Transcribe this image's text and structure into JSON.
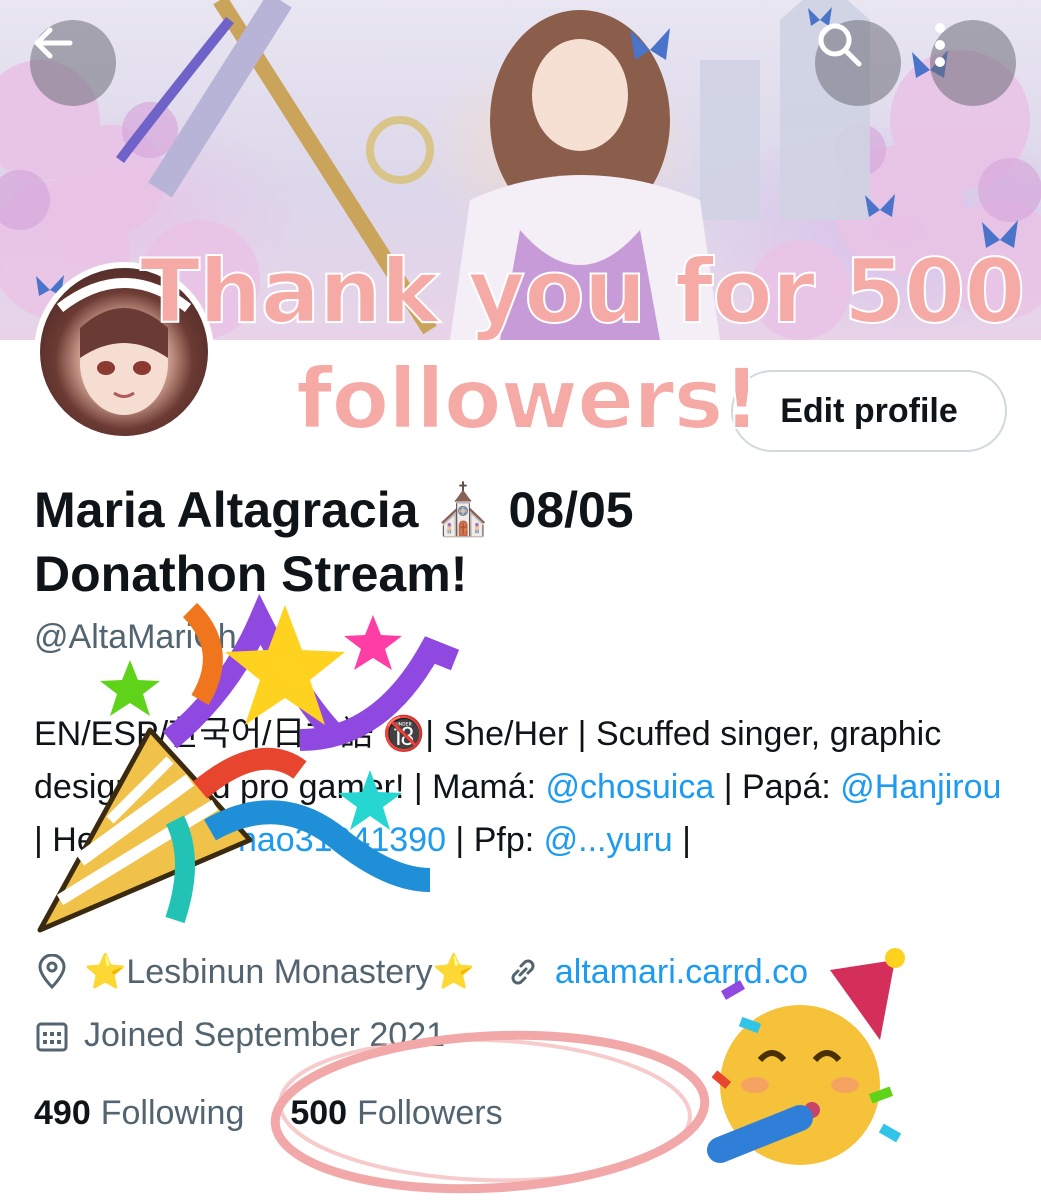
{
  "header": {
    "back_icon": "arrow-left-icon",
    "search_icon": "search-icon",
    "more_icon": "more-vertical-icon"
  },
  "overlay_text": {
    "line1": "Thank you for 500",
    "line2": "followers!"
  },
  "profile": {
    "edit_label": "Edit profile",
    "name": "Maria Altagracia ⛪ 08/05 Donathon Stream!",
    "handle": "@AltaMariCh",
    "bio": {
      "part1": "EN/ESP/한국어/日本語 🔞| She/Her | Scuffed singer, graphic designer and pro gamer! | Mamá: ",
      "mama": "@chosuica",
      "part2": " | Papá: ",
      "papa": "@Hanjirou",
      "part3": " | Header: ",
      "header_artist": "@Thao31941390",
      "part4": " | Pfp: ",
      "pfp_artist": "@...yuru",
      "part5": " |"
    },
    "location": "⭐Lesbinun Monastery⭐",
    "website": "altamari.carrd.co",
    "joined": "Joined September 2021",
    "following_count": "490",
    "following_label": "Following",
    "followers_count": "500",
    "followers_label": "Followers"
  },
  "colors": {
    "link": "#1d9bf0",
    "overlay_pink": "#f5aaa6",
    "circle_pink": "#f2a8a8"
  }
}
